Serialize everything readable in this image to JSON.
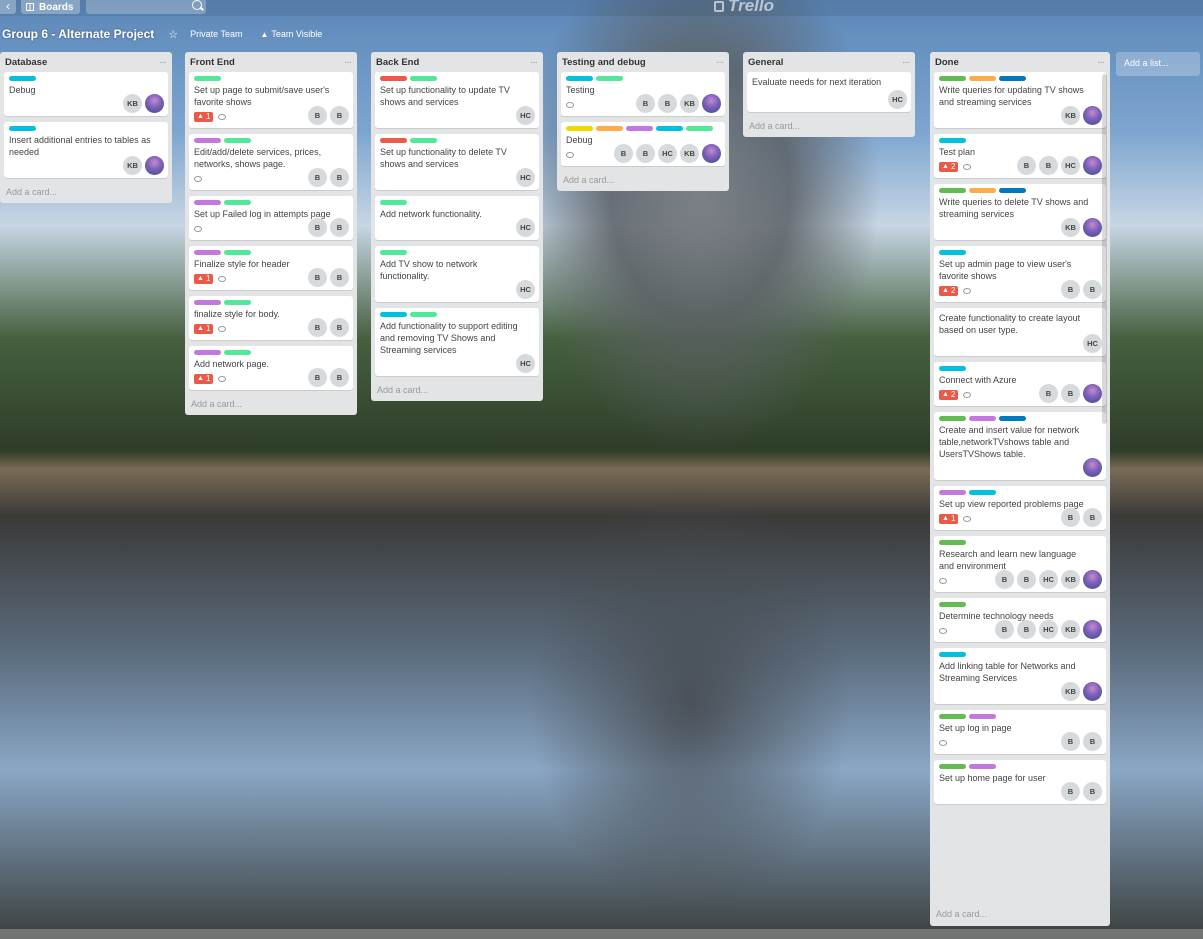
{
  "topbar": {
    "back_label": "‹",
    "boards_label": "Boards",
    "logo_text": "Trello"
  },
  "board": {
    "title": "Group 6 - Alternate Project",
    "team": "Private Team",
    "visibility": "Team Visible"
  },
  "add_list_label": "Add a list...",
  "add_card_label": "Add a card...",
  "colors": {
    "green": "#61bd4f",
    "yellow": "#f2d600",
    "orange": "#ffab4a",
    "red": "#eb5a46",
    "purple": "#c377e0",
    "blue": "#0079bf",
    "sky": "#00c2e0",
    "lime": "#51e898"
  },
  "lists": [
    {
      "title": "Database",
      "cards": [
        {
          "labels": [
            "sky"
          ],
          "title": "Debug",
          "notif": "",
          "watch": false,
          "members": [
            "KB",
            "photo"
          ]
        },
        {
          "labels": [
            "sky"
          ],
          "title": "Insert additional entries to tables as needed",
          "notif": "",
          "watch": false,
          "members": [
            "KB",
            "photo"
          ]
        }
      ]
    },
    {
      "title": "Front End",
      "cards": [
        {
          "labels": [
            "lime"
          ],
          "title": "Set up page to submit/save user's favorite shows",
          "notif": "1",
          "watch": true,
          "members": [
            "B",
            "B"
          ]
        },
        {
          "labels": [
            "purple",
            "lime"
          ],
          "title": "Edit/add/delete services, prices, networks, shows page.",
          "notif": "",
          "watch": true,
          "members": [
            "B",
            "B"
          ]
        },
        {
          "labels": [
            "purple",
            "lime"
          ],
          "title": "Set up Failed log in attempts page",
          "notif": "",
          "watch": true,
          "members": [
            "B",
            "B"
          ]
        },
        {
          "labels": [
            "purple",
            "lime"
          ],
          "title": "Finalize style for header",
          "notif": "1",
          "watch": true,
          "members": [
            "B",
            "B"
          ]
        },
        {
          "labels": [
            "purple",
            "lime"
          ],
          "title": "finalize style for body.",
          "notif": "1",
          "watch": true,
          "members": [
            "B",
            "B"
          ]
        },
        {
          "labels": [
            "purple",
            "lime"
          ],
          "title": "Add network page.",
          "notif": "1",
          "watch": true,
          "members": [
            "B",
            "B"
          ]
        }
      ]
    },
    {
      "title": "Back End",
      "cards": [
        {
          "labels": [
            "red",
            "lime"
          ],
          "title": "Set up functionality to update TV shows and services",
          "notif": "",
          "watch": false,
          "members": [
            "HC"
          ]
        },
        {
          "labels": [
            "red",
            "lime"
          ],
          "title": "Set up functionality to delete TV shows and services",
          "notif": "",
          "watch": false,
          "members": [
            "HC"
          ]
        },
        {
          "labels": [
            "lime"
          ],
          "title": "Add network functionality.",
          "notif": "",
          "watch": false,
          "members": [
            "HC"
          ]
        },
        {
          "labels": [
            "lime"
          ],
          "title": "Add TV show to network functionality.",
          "notif": "",
          "watch": false,
          "members": [
            "HC"
          ]
        },
        {
          "labels": [
            "sky",
            "lime"
          ],
          "title": "Add functionality to support editing and removing TV Shows and Streaming services",
          "notif": "",
          "watch": false,
          "members": [
            "HC"
          ]
        }
      ]
    },
    {
      "title": "Testing and debug",
      "cards": [
        {
          "labels": [
            "sky",
            "lime"
          ],
          "title": "Testing",
          "notif": "",
          "watch": true,
          "members": [
            "B",
            "B",
            "KB",
            "photo"
          ]
        },
        {
          "labels": [
            "yellow",
            "orange",
            "purple",
            "sky",
            "lime"
          ],
          "title": "Debug",
          "notif": "",
          "watch": true,
          "members": [
            "B",
            "B",
            "HC",
            "KB",
            "photo"
          ]
        }
      ]
    },
    {
      "title": "General",
      "cards": [
        {
          "labels": [],
          "title": "Evaluate needs for next iteration",
          "notif": "",
          "watch": false,
          "members": [
            "HC"
          ]
        }
      ]
    },
    {
      "title": "Done",
      "cards": [
        {
          "labels": [
            "green",
            "orange",
            "blue"
          ],
          "title": "Write queries for updating TV shows and streaming services",
          "notif": "",
          "watch": false,
          "members": [
            "KB",
            "photo"
          ]
        },
        {
          "labels": [
            "sky"
          ],
          "title": "Test plan",
          "notif": "2",
          "watch": true,
          "members": [
            "B",
            "B",
            "HC",
            "photo"
          ]
        },
        {
          "labels": [
            "green",
            "orange",
            "blue"
          ],
          "title": "Write queries to delete TV shows and streaming services",
          "notif": "",
          "watch": false,
          "members": [
            "KB",
            "photo"
          ]
        },
        {
          "labels": [
            "sky"
          ],
          "title": "Set up admin page to view user's favorite shows",
          "notif": "2",
          "watch": true,
          "members": [
            "B",
            "B"
          ]
        },
        {
          "labels": [],
          "title": "Create functionality to create layout based on user type.",
          "notif": "",
          "watch": false,
          "members": [
            "HC"
          ]
        },
        {
          "labels": [
            "sky"
          ],
          "title": "Connect with Azure",
          "notif": "2",
          "watch": true,
          "members": [
            "B",
            "B",
            "photo"
          ]
        },
        {
          "labels": [
            "green",
            "purple",
            "blue"
          ],
          "title": "Create and insert value for network table,networkTVshows table and UsersTVShows table.",
          "notif": "",
          "watch": false,
          "members": [
            "photo"
          ]
        },
        {
          "labels": [
            "purple",
            "sky"
          ],
          "title": "Set up view reported problems page",
          "notif": "1",
          "watch": true,
          "members": [
            "B",
            "B"
          ]
        },
        {
          "labels": [
            "green"
          ],
          "title": "Research and learn new language and environment",
          "notif": "",
          "watch": true,
          "members": [
            "B",
            "B",
            "HC",
            "KB",
            "photo"
          ]
        },
        {
          "labels": [
            "green"
          ],
          "title": "Determine technology needs",
          "notif": "",
          "watch": true,
          "members": [
            "B",
            "B",
            "HC",
            "KB",
            "photo"
          ]
        },
        {
          "labels": [
            "sky"
          ],
          "title": "Add linking table for Networks and Streaming Services",
          "notif": "",
          "watch": false,
          "members": [
            "KB",
            "photo"
          ]
        },
        {
          "labels": [
            "green",
            "purple"
          ],
          "title": "Set up log in page",
          "notif": "",
          "watch": true,
          "members": [
            "B",
            "B"
          ]
        },
        {
          "labels": [
            "green",
            "purple"
          ],
          "title": "Set up home page for user",
          "notif": "",
          "watch": false,
          "members": [
            "B",
            "B"
          ]
        }
      ]
    }
  ]
}
